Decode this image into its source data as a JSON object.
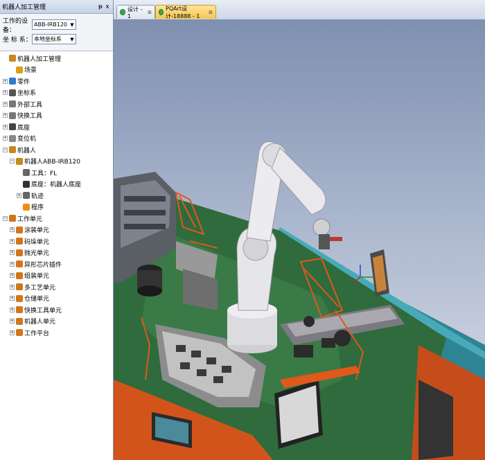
{
  "panel": {
    "title": "机器人加工管理",
    "pin": "ᵽ",
    "close": "x"
  },
  "form": {
    "work_device_label": "工作的设备：",
    "work_device_value": "ABB-IRB120",
    "coord_label": "坐  标  系：",
    "coord_value": "本地坐标系"
  },
  "tree": [
    {
      "label": "机器人加工管理",
      "level": 0,
      "exp": "",
      "icon": "robot-manage-icon",
      "color": "#c58a1c"
    },
    {
      "label": "场景",
      "level": 1,
      "exp": "",
      "icon": "scene-icon",
      "color": "#d4a11a"
    },
    {
      "label": "零件",
      "level": 0,
      "exp": "+",
      "icon": "part-icon",
      "color": "#2f7bd4"
    },
    {
      "label": "坐标系",
      "level": 0,
      "exp": "+",
      "icon": "coordinate-icon",
      "color": "#555555"
    },
    {
      "label": "外部工具",
      "level": 0,
      "exp": "+",
      "icon": "external-tool-icon",
      "color": "#777777"
    },
    {
      "label": "快换工具",
      "level": 0,
      "exp": "+",
      "icon": "quick-change-tool-icon",
      "color": "#777777"
    },
    {
      "label": "底座",
      "level": 0,
      "exp": "+",
      "icon": "base-icon",
      "color": "#444444"
    },
    {
      "label": "变位机",
      "level": 0,
      "exp": "+",
      "icon": "positioner-icon",
      "color": "#888888"
    },
    {
      "label": "机器人",
      "level": 0,
      "exp": "−",
      "icon": "robot-icon",
      "color": "#c58a1c"
    },
    {
      "label": "机器人ABB-IRB120",
      "level": 1,
      "exp": "−",
      "icon": "robot-arm-icon",
      "color": "#c58a1c"
    },
    {
      "label": "工具：FL",
      "level": 2,
      "exp": "",
      "icon": "tool-icon",
      "color": "#666666"
    },
    {
      "label": "底座：机器人底座",
      "level": 2,
      "exp": "",
      "icon": "robot-base-icon",
      "color": "#333333"
    },
    {
      "label": "轨迹",
      "level": 2,
      "exp": "+",
      "icon": "trajectory-icon",
      "color": "#666666"
    },
    {
      "label": "程序",
      "level": 2,
      "exp": "",
      "icon": "program-icon",
      "color": "#f08a1c"
    },
    {
      "label": "工作单元",
      "level": 0,
      "exp": "−",
      "icon": "work-unit-folder-icon",
      "color": "#d2761a"
    },
    {
      "label": "涂装单元",
      "level": 1,
      "exp": "+",
      "icon": "unit-icon",
      "color": "#d2761a"
    },
    {
      "label": "码垛单元",
      "level": 1,
      "exp": "+",
      "icon": "unit-icon",
      "color": "#d2761a"
    },
    {
      "label": "抛光单元",
      "level": 1,
      "exp": "+",
      "icon": "unit-icon",
      "color": "#d2761a"
    },
    {
      "label": "异形芯片插件",
      "level": 1,
      "exp": "+",
      "icon": "unit-icon",
      "color": "#d2761a"
    },
    {
      "label": "组装单元",
      "level": 1,
      "exp": "+",
      "icon": "unit-icon",
      "color": "#d2761a"
    },
    {
      "label": "多工艺单元",
      "level": 1,
      "exp": "+",
      "icon": "unit-icon",
      "color": "#d2761a"
    },
    {
      "label": "仓储单元",
      "level": 1,
      "exp": "+",
      "icon": "unit-icon",
      "color": "#d2761a"
    },
    {
      "label": "快换工具单元",
      "level": 1,
      "exp": "+",
      "icon": "unit-icon",
      "color": "#d2761a"
    },
    {
      "label": "机器人单元",
      "level": 1,
      "exp": "+",
      "icon": "unit-icon",
      "color": "#d2761a"
    },
    {
      "label": "工作平台",
      "level": 1,
      "exp": "+",
      "icon": "unit-icon",
      "color": "#d2761a"
    }
  ],
  "tabs": [
    {
      "label": "设计 - 1",
      "close": "⊠",
      "active": false
    },
    {
      "label": "PQArt设计-18888 - 1",
      "close": "⊠",
      "active": true
    }
  ],
  "colors": {
    "accent_tab": "#f7c54e",
    "robot_body": "#e6e6ea",
    "frame_orange": "#e0581c",
    "platform_teal": "#3f9aa8"
  }
}
